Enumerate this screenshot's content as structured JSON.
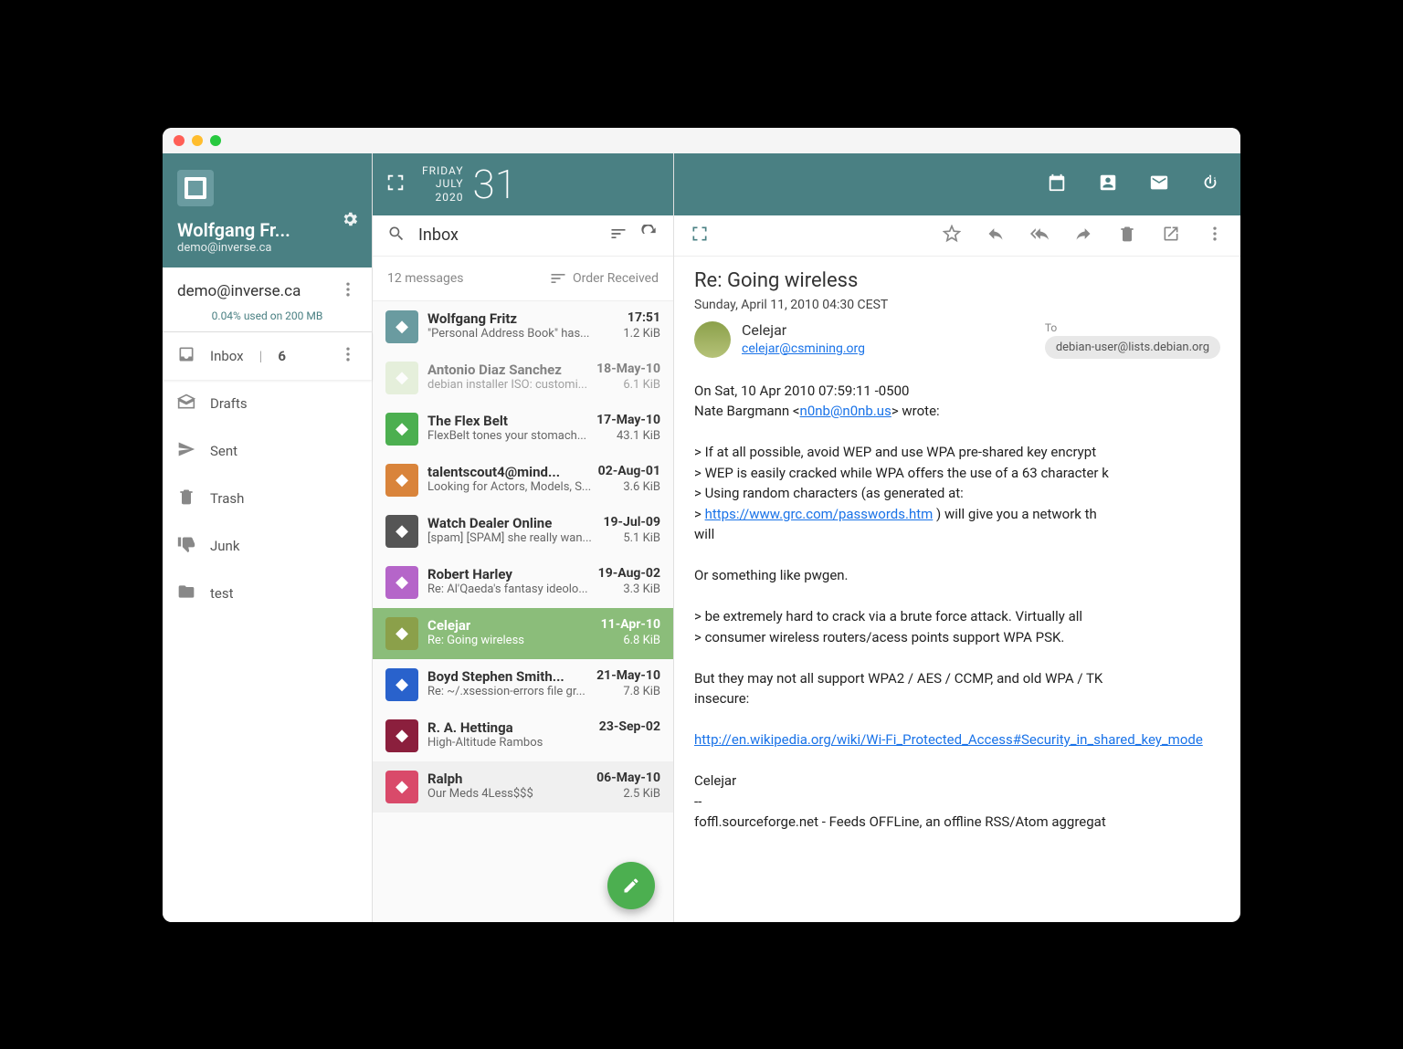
{
  "user": {
    "name": "Wolfgang Fr...",
    "email": "demo@inverse.ca"
  },
  "account": "demo@inverse.ca",
  "quota": "0.04% used on 200 MB",
  "date": {
    "weekday": "FRIDAY",
    "month": "JULY",
    "year": "2020",
    "day": "31"
  },
  "folders": [
    {
      "icon": "inbox",
      "label": "Inbox",
      "count": "6",
      "active": true,
      "more": true
    },
    {
      "icon": "drafts",
      "label": "Drafts"
    },
    {
      "icon": "sent",
      "label": "Sent"
    },
    {
      "icon": "trash",
      "label": "Trash"
    },
    {
      "icon": "junk",
      "label": "Junk"
    },
    {
      "icon": "folder",
      "label": "test"
    }
  ],
  "search": {
    "label": "Inbox"
  },
  "list": {
    "count": "12 messages",
    "sort": "Order Received"
  },
  "messages": [
    {
      "from": "Wolfgang Fritz",
      "date": "17:51",
      "subject": "\"Personal Address Book\" has...",
      "size": "1.2 KiB",
      "avatar": "#6a9ba0"
    },
    {
      "from": "Antonio Diaz Sanchez",
      "date": "18-May-10",
      "subject": "debian installer ISO: customi...",
      "size": "6.1 KiB",
      "avatar": "#d8e8c8",
      "read": true
    },
    {
      "from": "The Flex Belt",
      "date": "17-May-10",
      "subject": "FlexBelt tones your stomach...",
      "size": "43.1 KiB",
      "avatar": "#4caf50"
    },
    {
      "from": "talentscout4@mind...",
      "date": "02-Aug-01",
      "subject": "Looking for Actors, Models, S...",
      "size": "3.6 KiB",
      "avatar": "#d9843b"
    },
    {
      "from": "Watch Dealer Online",
      "date": "19-Jul-09",
      "subject": "[spam] [SPAM] she really wan...",
      "size": "5.1 KiB",
      "avatar": "#555"
    },
    {
      "from": "Robert Harley",
      "date": "19-Aug-02",
      "subject": "Re: Al'Qaeda's fantasy ideolo...",
      "size": "3.3 KiB",
      "avatar": "#b565c9"
    },
    {
      "from": "Celejar",
      "date": "11-Apr-10",
      "subject": "Re: Going wireless",
      "size": "6.8 KiB",
      "avatar": "#8ba04a",
      "selected": true
    },
    {
      "from": "Boyd Stephen Smith...",
      "date": "21-May-10",
      "subject": "Re: ~/.xsession-errors file gr...",
      "size": "7.8 KiB",
      "avatar": "#2962cc"
    },
    {
      "from": "R. A. Hettinga",
      "date": "23-Sep-02",
      "subject": "High-Altitude Rambos",
      "size": "",
      "avatar": "#8b1f3d"
    },
    {
      "from": "Ralph",
      "date": "06-May-10",
      "subject": "Our Meds 4Less$$$",
      "size": "2.5 KiB",
      "avatar": "#d94a6a",
      "last": true
    }
  ],
  "mail": {
    "subject": "Re: Going wireless",
    "datetime": "Sunday, April 11, 2010 04:30 CEST",
    "from_name": "Celejar",
    "from_email": "celejar@csmining.org",
    "to_label": "To",
    "to": "debian-user@lists.debian.org",
    "body_intro": "On Sat, 10 Apr 2010 07:59:11 -0500\nNate Bargmann <",
    "body_email": "n0nb@n0nb.us",
    "body_after_email": "> wrote:",
    "quote1": "> If at all possible, avoid WEP and use WPA pre-shared key encrypt\n> WEP is easily cracked while WPA offers the use of a 63 character k\n> Using random characters (as generated at:\n> ",
    "link1": "https://www.grc.com/passwords.htm",
    "quote1b": " ) will give you a network th\nwill",
    "para1": "Or something like pwgen.",
    "quote2": "> be extremely hard to crack via a brute force attack.  Virtually all\n> consumer wireless routers/acess points support WPA PSK.",
    "para2": "But they may not all support WPA2 / AES / CCMP, and old WPA / TK\ninsecure:",
    "link2": "http://en.wikipedia.org/wiki/Wi-Fi_Protected_Access#Security_in_shared_key_mode",
    "sig": "Celejar\n--\nfoffl.sourceforge.net - Feeds OFFLine, an offline RSS/Atom aggregat"
  }
}
